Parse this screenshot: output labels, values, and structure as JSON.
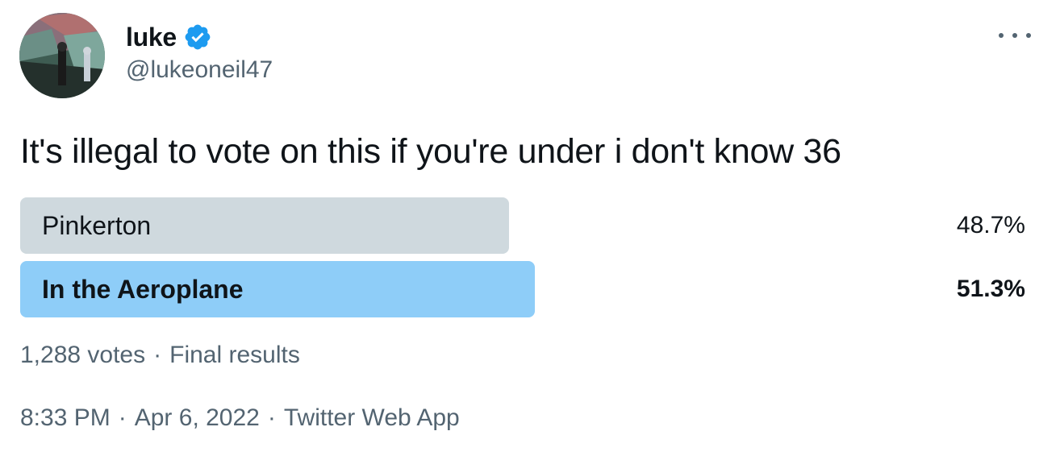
{
  "author": {
    "display_name": "luke",
    "handle": "@lukeoneil47",
    "verified_icon": "verified-badge-icon",
    "accent_color": "#1d9bf0"
  },
  "more_menu_icon": "ellipsis-icon",
  "tweet": {
    "text": "It's illegal to vote on this if you're under i don't know 36"
  },
  "poll": {
    "options": [
      {
        "label": "Pinkerton",
        "percent_label": "48.7%",
        "percent": 48.7,
        "bar_color": "#cfd9de",
        "winner": false
      },
      {
        "label": "In the Aeroplane",
        "percent_label": "51.3%",
        "percent": 51.3,
        "bar_color": "#8ecdf8",
        "winner": true
      }
    ],
    "votes": "1,288 votes",
    "meta_separator": "·",
    "status": "Final results"
  },
  "timestamp": {
    "time": "8:33 PM",
    "separator": "·",
    "date": "Apr 6, 2022",
    "source": "Twitter Web App"
  }
}
